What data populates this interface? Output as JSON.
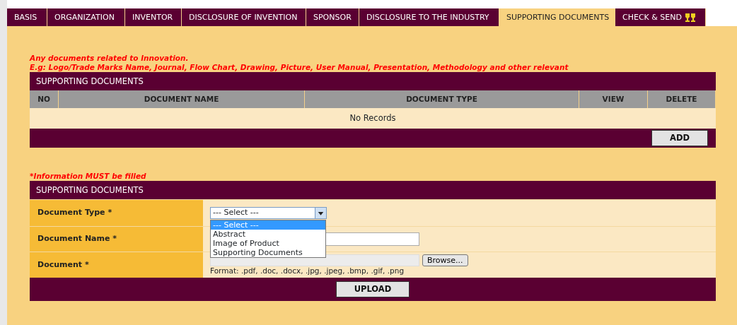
{
  "tabs": [
    {
      "label": "BASIS",
      "selected": false
    },
    {
      "label": "ORGANIZATION",
      "selected": false
    },
    {
      "label": "INVENTOR",
      "selected": false
    },
    {
      "label": "DISCLOSURE OF INVENTION",
      "selected": false
    },
    {
      "label": "SPONSOR",
      "selected": false
    },
    {
      "label": "DISCLOSURE TO THE INDUSTRY",
      "selected": false
    },
    {
      "label": "SUPPORTING DOCUMENTS",
      "selected": true
    },
    {
      "label": "CHECK & SEND",
      "selected": false,
      "icon": true
    }
  ],
  "notes": [
    "Any documents related to Innovation.",
    "E.g: Logo/Trade Marks Name, Journal, Flow Chart, Drawing, Picture, User Manual, Presentation, Methodology and other relevant"
  ],
  "documents_table": {
    "title": "SUPPORTING DOCUMENTS",
    "columns": [
      "NO",
      "DOCUMENT NAME",
      "DOCUMENT TYPE",
      "VIEW",
      "DELETE"
    ],
    "empty_text": "No Records",
    "add_button": "ADD"
  },
  "required_note": "*Information MUST be filled",
  "upload_form": {
    "title": "SUPPORTING DOCUMENTS",
    "fields": [
      {
        "label": "Document Type *",
        "kind": "select",
        "value": "--- Select ---",
        "expanded": true,
        "options": [
          {
            "label": "--- Select ---",
            "selected": true
          },
          {
            "label": "Abstract",
            "selected": false
          },
          {
            "label": "Image of Product",
            "selected": false
          },
          {
            "label": "Supporting Documents",
            "selected": false
          }
        ]
      },
      {
        "label": "Document Name *",
        "kind": "text"
      },
      {
        "label": "Document *",
        "kind": "file",
        "browse_button": "Browse...",
        "hint": "Format: .pdf, .doc, .docx, .jpg, .jpeg, .bmp, .gif, .png"
      }
    ],
    "upload_button": "UPLOAD"
  }
}
